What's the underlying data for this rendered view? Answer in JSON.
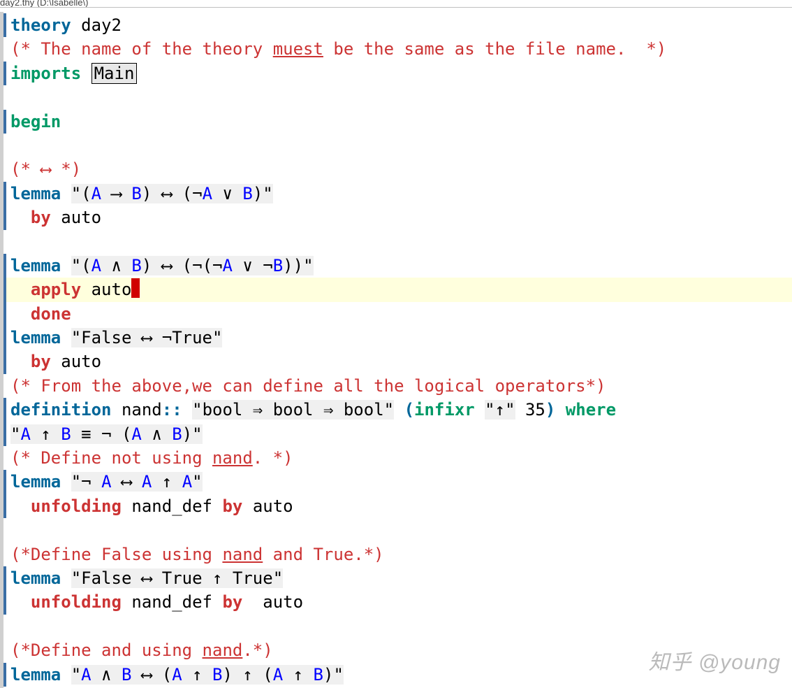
{
  "titlebar": "day2.thy (D:\\Isabelle\\)",
  "watermark": "知乎 @young",
  "t": {
    "theory": "theory",
    "imports": "imports",
    "begin": "begin",
    "lemma": "lemma",
    "by": "by",
    "apply": "apply",
    "done": "done",
    "definition": "definition",
    "infixr": "infixr",
    "where": "where",
    "unfolding": "unfolding",
    "day2": "day2",
    "Main": "Main",
    "auto": "auto",
    "nand": "nand",
    "nand_def": "nand_def",
    "infix_prec": "35",
    "infix_sym": "↑",
    "q": "\"",
    "ob": "(",
    "cb": ")",
    "sp": " ",
    "A": "A",
    "B": "B",
    "cm_theory": "(* The name of the theory ",
    "cm_muest": "muest",
    "cm_theory2": " be the same as the file name.  *)",
    "cm_iff": "(* ⟷ *)",
    "cm_allops": "(* From the above,we can define all the logical operators*)",
    "cm_not1": "(* Define not using ",
    "cm_nand": "nand",
    "cm_not2": ". *)",
    "cm_false1": "(*Define False using ",
    "cm_false2": " and True.*)",
    "cm_and1": "(*Define and using ",
    "cm_and2": ".*)",
    "s_l1a": "(",
    "s_l1b": " ⟶ ",
    "s_l1c": ") ⟷ (¬",
    "s_l1d": " ∨ ",
    "s_l1e": ")",
    "s_l2a": "(",
    "s_l2b": " ∧ ",
    "s_l2c": ") ⟷ (¬(¬",
    "s_l2d": " ∨ ¬",
    "s_l2e": "))",
    "s_l3": "False ⟷ ¬True",
    "def_sig": "bool ⇒ bool ⇒ bool",
    "def_bod1": " ↑ ",
    "def_bod2": " ≡ ¬ (",
    "def_bod3": " ∧ ",
    "def_bod4": ")",
    "s_l4a": "¬ ",
    "s_l4b": " ⟷ ",
    "s_l4c": " ↑ ",
    "s_l5": "False ⟷ True ↑ True",
    "s_l6a": " ∧ ",
    "s_l6b": " ⟷ (",
    "s_l6c": " ↑ ",
    "s_l6d": ") ↑ (",
    "s_l6e": " ↑ ",
    "s_l6f": ")"
  }
}
